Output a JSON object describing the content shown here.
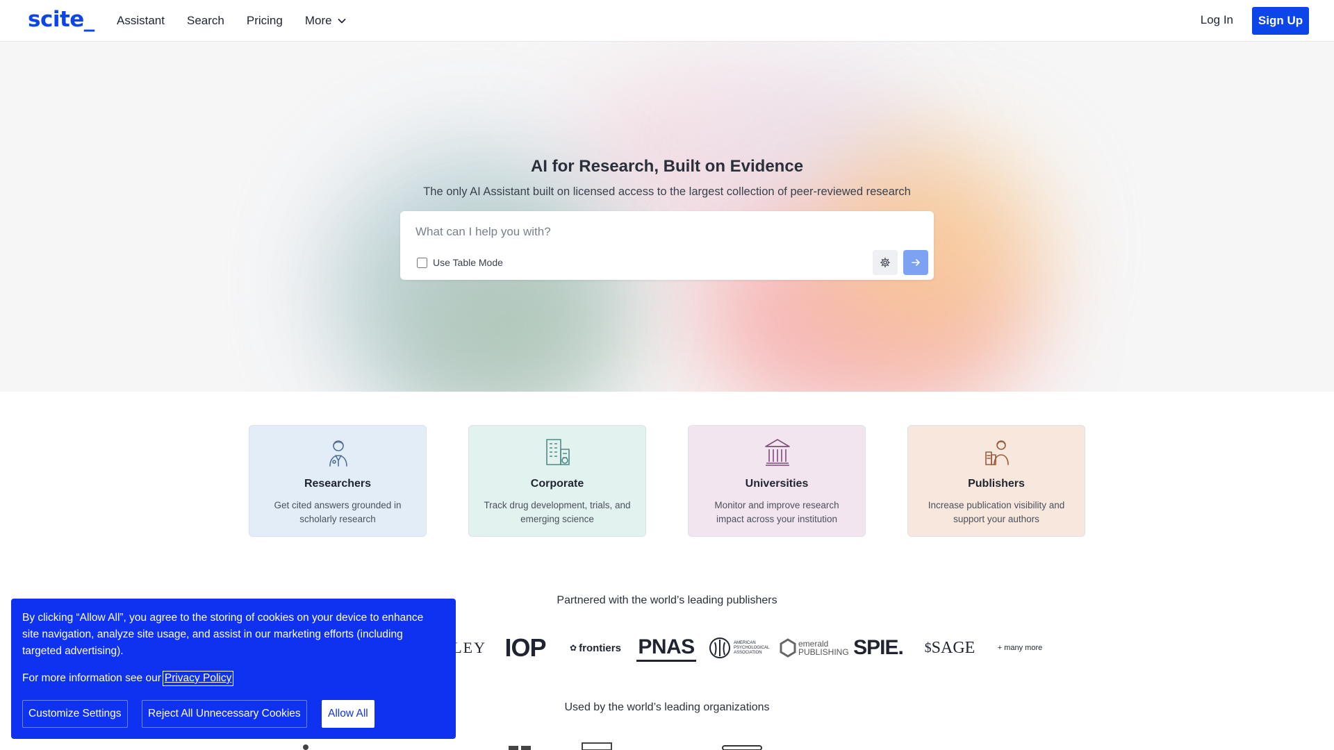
{
  "header": {
    "logo": "scite_",
    "nav": [
      "Assistant",
      "Search",
      "Pricing",
      "More"
    ],
    "login": "Log In",
    "signup": "Sign Up",
    "brand_color": "#0c46e8"
  },
  "hero": {
    "title": "AI for Research, Built on Evidence",
    "subtitle": "The only AI Assistant built on licensed access to the largest collection of peer-reviewed research",
    "search_placeholder": "What can I help you with?",
    "table_mode_label": "Use Table Mode",
    "table_mode_checked": false,
    "settings_icon": "gear-icon",
    "send_icon": "arrow-right-icon"
  },
  "cards": [
    {
      "icon": "researcher-icon",
      "title": "Researchers",
      "desc": "Get cited answers grounded in scholarly research",
      "bg": "#e3edf8",
      "icon_color": "#4f6f95"
    },
    {
      "icon": "corporate-icon",
      "title": "Corporate",
      "desc": "Track drug development, trials, and emerging science",
      "bg": "#e2f2ef",
      "icon_color": "#4e8a86"
    },
    {
      "icon": "university-icon",
      "title": "Universities",
      "desc": "Monitor and improve research impact across your institution",
      "bg": "#f3e5f0",
      "icon_color": "#7b4d78"
    },
    {
      "icon": "publisher-icon",
      "title": "Publishers",
      "desc": "Increase publication visibility and support your authors",
      "bg": "#f8e7dd",
      "icon_color": "#9a5a3a"
    }
  ],
  "partners": {
    "label": "Partnered with the world’s leading publishers",
    "logos": [
      "WILEY",
      "IOP",
      "frontiers",
      "PNAS",
      "AMERICAN PSYCHOLOGICAL ASSOCIATION",
      "emerald PUBLISHING",
      "SPIE.",
      "SAGE",
      "+ many more"
    ]
  },
  "orgs": {
    "label": "Used by the world’s leading organizations"
  },
  "cookie": {
    "text": "By clicking “Allow All”, you agree to the storing of cookies on your device to enhance site navigation, analyze site usage, and assist in our marketing efforts (including targeted advertising).",
    "more_prefix": "For more information see our",
    "privacy_link": "Privacy Policy",
    "customize": "Customize Settings",
    "reject": "Reject All Unnecessary Cookies",
    "allow": "Allow All",
    "bg_color": "#0e32f0"
  }
}
